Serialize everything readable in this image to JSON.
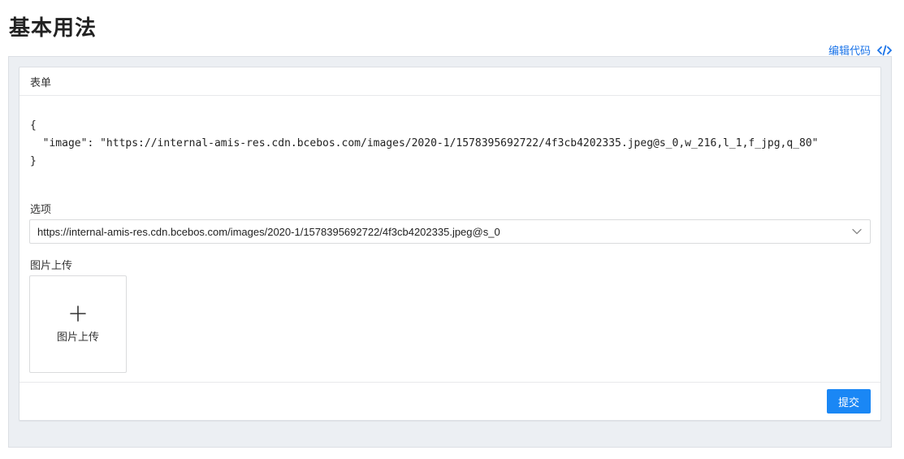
{
  "page": {
    "title": "基本用法",
    "edit_code_label": "编辑代码"
  },
  "panel": {
    "heading": "表单",
    "json_text": "{\n  \"image\": \"https://internal-amis-res.cdn.bcebos.com/images/2020-1/1578395692722/4f3cb4202335.jpeg@s_0,w_216,l_1,f_jpg,q_80\"\n}",
    "select": {
      "label": "选项",
      "value": "https://internal-amis-res.cdn.bcebos.com/images/2020-1/1578395692722/4f3cb4202335.jpeg@s_0"
    },
    "upload": {
      "label": "图片上传",
      "button_text": "图片上传"
    },
    "submit_label": "提交"
  },
  "icons": {
    "code": "code-icon",
    "caret": "chevron-down-icon",
    "plus": "plus-icon"
  },
  "colors": {
    "accent": "#1a87f5",
    "link": "#1a73e8",
    "preview_bg": "#eceff3"
  }
}
